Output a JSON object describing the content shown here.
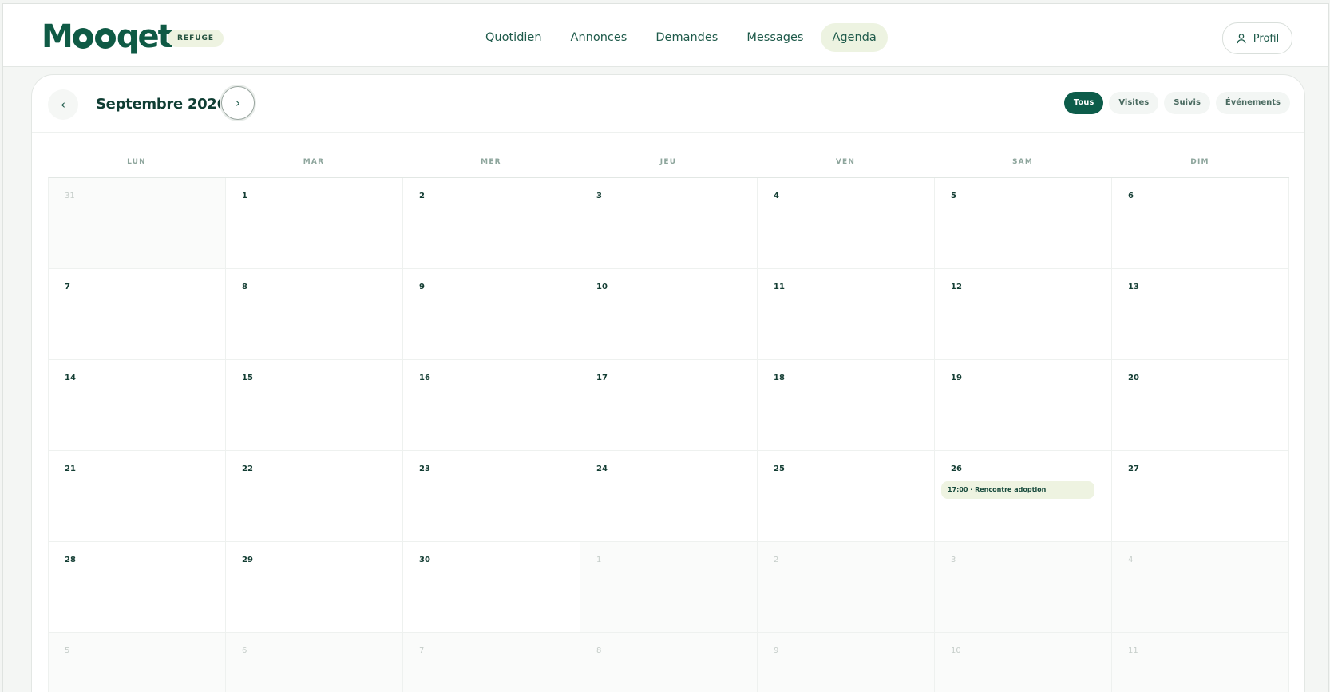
{
  "header": {
    "logo_text": "Mooqet",
    "badge": "REFUGE",
    "nav": [
      {
        "label": "Quotidien",
        "active": false
      },
      {
        "label": "Annonces",
        "active": false
      },
      {
        "label": "Demandes",
        "active": false
      },
      {
        "label": "Messages",
        "active": false
      },
      {
        "label": "Agenda",
        "active": true
      }
    ],
    "profile_label": "Profil",
    "profile_icon": "user-icon"
  },
  "calendar": {
    "month_label": "Septembre 2026",
    "prev_icon": "chevron-left-icon",
    "next_icon": "chevron-right-icon",
    "filters": [
      {
        "label": "Tous",
        "active": true
      },
      {
        "label": "Visites",
        "active": false
      },
      {
        "label": "Suivis",
        "active": false
      },
      {
        "label": "Événements",
        "active": false
      }
    ],
    "weekdays": [
      "LUN",
      "MAR",
      "MER",
      "JEU",
      "VEN",
      "SAM",
      "DIM"
    ],
    "days": [
      {
        "n": "31",
        "muted": true
      },
      {
        "n": "1"
      },
      {
        "n": "2"
      },
      {
        "n": "3"
      },
      {
        "n": "4"
      },
      {
        "n": "5"
      },
      {
        "n": "6"
      },
      {
        "n": "7"
      },
      {
        "n": "8"
      },
      {
        "n": "9"
      },
      {
        "n": "10"
      },
      {
        "n": "11"
      },
      {
        "n": "12"
      },
      {
        "n": "13"
      },
      {
        "n": "14"
      },
      {
        "n": "15"
      },
      {
        "n": "16"
      },
      {
        "n": "17"
      },
      {
        "n": "18"
      },
      {
        "n": "19"
      },
      {
        "n": "20"
      },
      {
        "n": "21"
      },
      {
        "n": "22"
      },
      {
        "n": "23"
      },
      {
        "n": "24"
      },
      {
        "n": "25"
      },
      {
        "n": "26",
        "events": [
          "17:00 · Rencontre adoption"
        ]
      },
      {
        "n": "27"
      },
      {
        "n": "28"
      },
      {
        "n": "29"
      },
      {
        "n": "30"
      },
      {
        "n": "1",
        "muted": true
      },
      {
        "n": "2",
        "muted": true
      },
      {
        "n": "3",
        "muted": true
      },
      {
        "n": "4",
        "muted": true
      },
      {
        "n": "5",
        "muted": true
      },
      {
        "n": "6",
        "muted": true
      },
      {
        "n": "7",
        "muted": true
      },
      {
        "n": "8",
        "muted": true
      },
      {
        "n": "9",
        "muted": true
      },
      {
        "n": "10",
        "muted": true
      },
      {
        "n": "11",
        "muted": true
      }
    ]
  },
  "colors": {
    "brand": "#0d5c4a",
    "accent_soft": "#eef3e1"
  }
}
